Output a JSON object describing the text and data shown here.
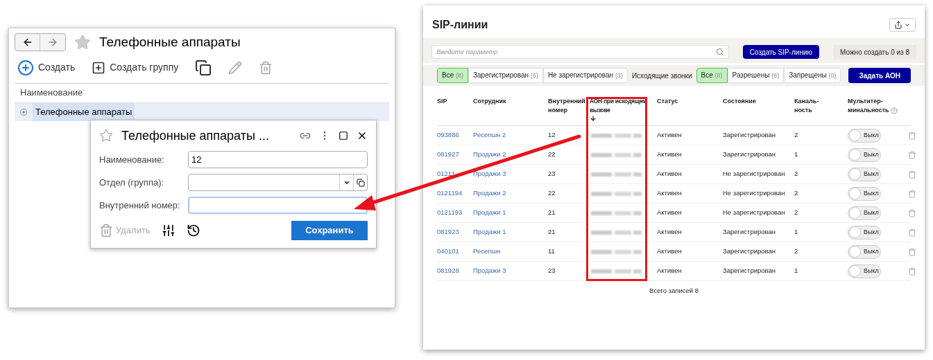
{
  "catalog": {
    "title": "Телефонные аппараты",
    "toolbar": [
      {
        "kind": "create",
        "label": "Создать"
      },
      {
        "kind": "group",
        "label": "Создать группу"
      },
      {
        "kind": "copy"
      },
      {
        "kind": "edit"
      },
      {
        "kind": "delete"
      }
    ],
    "column": "Наименование",
    "rows": [
      {
        "label": "Телефонные аппараты",
        "selected": true
      }
    ]
  },
  "dialog": {
    "title": "Телефонные аппараты ...",
    "fields": [
      {
        "kind": "text",
        "label": "Наименование:",
        "value": "12",
        "focused": false
      },
      {
        "kind": "select",
        "label": "Отдел (группа):",
        "focused": false
      },
      {
        "kind": "text",
        "label": "Внутренний номер:",
        "focused": true
      }
    ],
    "delete_label": "Удалить",
    "save_label": "Сохранить"
  },
  "sip": {
    "title": "SIP-линии",
    "search": {
      "placeholder": "Введите параметр"
    },
    "create_button": "Создать SIP-линию",
    "limit_note": "Можно создать 0 из 8",
    "status_filters": [
      {
        "label": "Все",
        "count": "(8)",
        "selected": true
      },
      {
        "label": "Зарегистрирован",
        "count": "(5)",
        "selected": false
      },
      {
        "label": "Не зарегистрирован",
        "count": "(3)",
        "selected": false
      }
    ],
    "calls_label": "Исходящие звонки",
    "call_filters": [
      {
        "label": "Все",
        "count": "(8)",
        "selected": true
      },
      {
        "label": "Разрешены",
        "count": "(8)",
        "selected": false
      },
      {
        "label": "Запрещены",
        "count": "(0)",
        "selected": false
      }
    ],
    "aon_button": "Задать АОН",
    "columns": [
      "SIP",
      "Сотрудник",
      "Внутренний\nномер",
      "АОН при исходящем\nвызове",
      "Статус",
      "Состояние",
      "Каналь-\nность",
      "Мультитер-\nминальность"
    ],
    "rows": [
      {
        "sip": "093886",
        "employee": "Ресепшн 2",
        "ext": "12",
        "status": "Активен",
        "state": "Зарегистрирован",
        "channels": "2",
        "multi": {
          "label": "Выкл",
          "on": false
        }
      },
      {
        "sip": "081927",
        "employee": "Продажи 2",
        "ext": "22",
        "status": "Активен",
        "state": "Зарегистрирован",
        "channels": "1",
        "multi": {
          "label": "Выкл",
          "on": false
        }
      },
      {
        "sip": "01211",
        "employee": "Продажи 3",
        "ext": "23",
        "status": "Активен",
        "state": "Не зарегистрирован",
        "channels": "2",
        "multi": {
          "label": "Выкл",
          "on": false
        }
      },
      {
        "sip": "0121194",
        "employee": "Продажи 2",
        "ext": "22",
        "status": "Активен",
        "state": "Не зарегистрирован",
        "channels": "2",
        "multi": {
          "label": "Выкл",
          "on": false
        }
      },
      {
        "sip": "0121193",
        "employee": "Продажи 1",
        "ext": "21",
        "status": "Активен",
        "state": "Не зарегистрирован",
        "channels": "2",
        "multi": {
          "label": "Выкл",
          "on": false
        }
      },
      {
        "sip": "081923",
        "employee": "Продажи 1",
        "ext": "21",
        "status": "Активен",
        "state": "Зарегистрирован",
        "channels": "1",
        "multi": {
          "label": "Выкл",
          "on": false
        }
      },
      {
        "sip": "040101",
        "employee": "Ресепшн",
        "ext": "11",
        "status": "Активен",
        "state": "Зарегистрирован",
        "channels": "2",
        "multi": {
          "label": "Выкл",
          "on": false
        }
      },
      {
        "sip": "081928",
        "employee": "Продажи 3",
        "ext": "23",
        "status": "Активен",
        "state": "Зарегистрирован",
        "channels": "1",
        "multi": {
          "label": "Выкл",
          "on": false
        }
      }
    ],
    "total": "Всего записей 8"
  }
}
